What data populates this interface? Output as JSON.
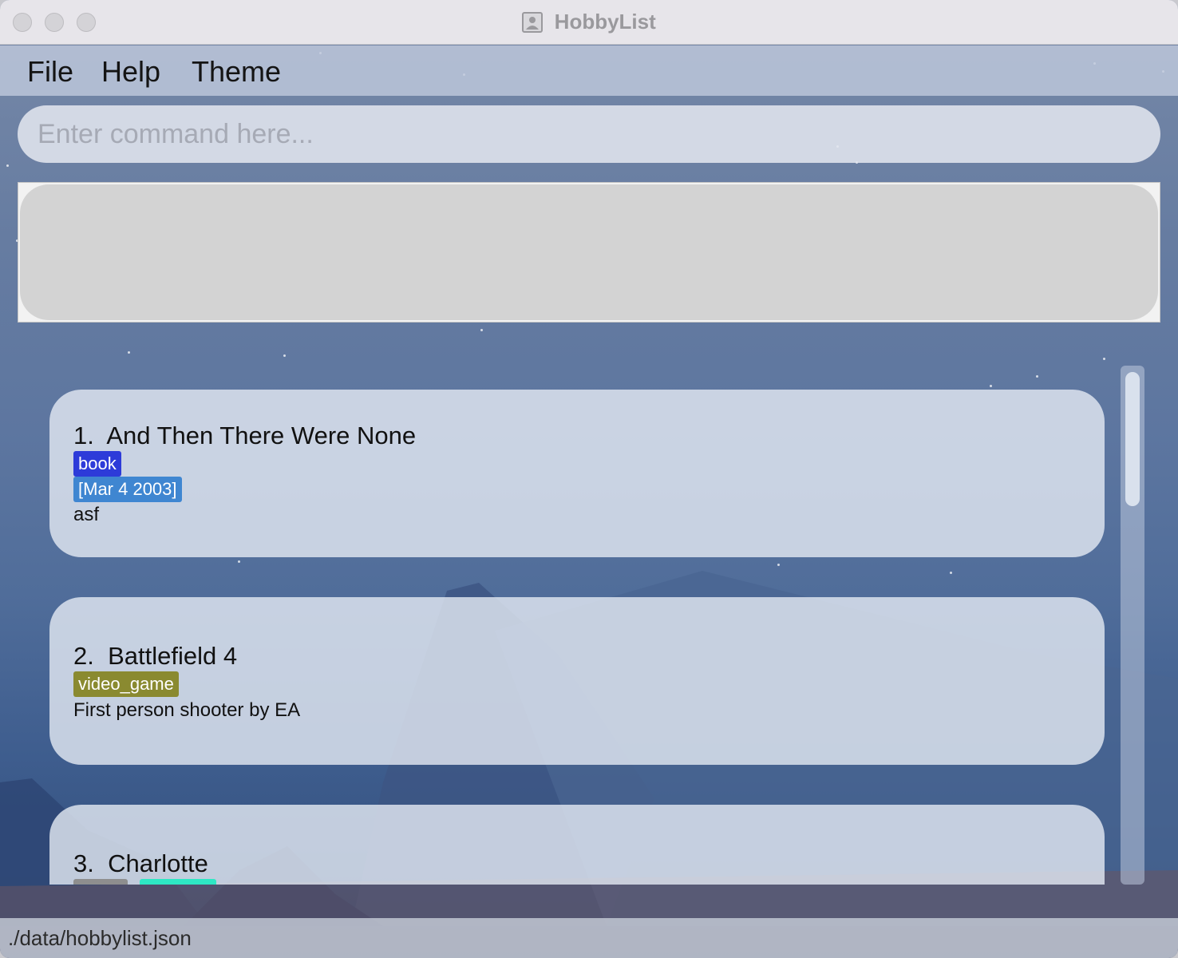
{
  "window": {
    "title": "HobbyList",
    "icon": "app-contact-icon"
  },
  "menu": [
    {
      "label": "File"
    },
    {
      "label": "Help"
    },
    {
      "label": "Theme"
    }
  ],
  "command": {
    "placeholder": "Enter command here...",
    "value": ""
  },
  "result": {
    "text": ""
  },
  "activities": [
    {
      "index": "1.",
      "name": "And Then There Were None",
      "tags": [
        {
          "text": "book",
          "color": "#2d3bd9"
        },
        {
          "text": "[Mar 4 2003]",
          "color": "#3f86d1"
        }
      ],
      "description": "asf"
    },
    {
      "index": "2.",
      "name": "Battlefield 4",
      "tags": [
        {
          "text": "video_game",
          "color": "#8a8a30"
        }
      ],
      "description": "First person shooter by EA"
    },
    {
      "index": "3.",
      "name": "Charlotte",
      "tags": [
        {
          "text": "",
          "color": "#8e8e8e"
        },
        {
          "text": "",
          "color": "#2ee8c4"
        }
      ],
      "description": ""
    }
  ],
  "status": {
    "path": "./data/hobbylist.json"
  },
  "colors": {
    "accent_book": "#2d3bd9",
    "accent_date": "#3f86d1",
    "accent_video_game": "#8a8a30",
    "background_sky": "#5d76a0"
  }
}
